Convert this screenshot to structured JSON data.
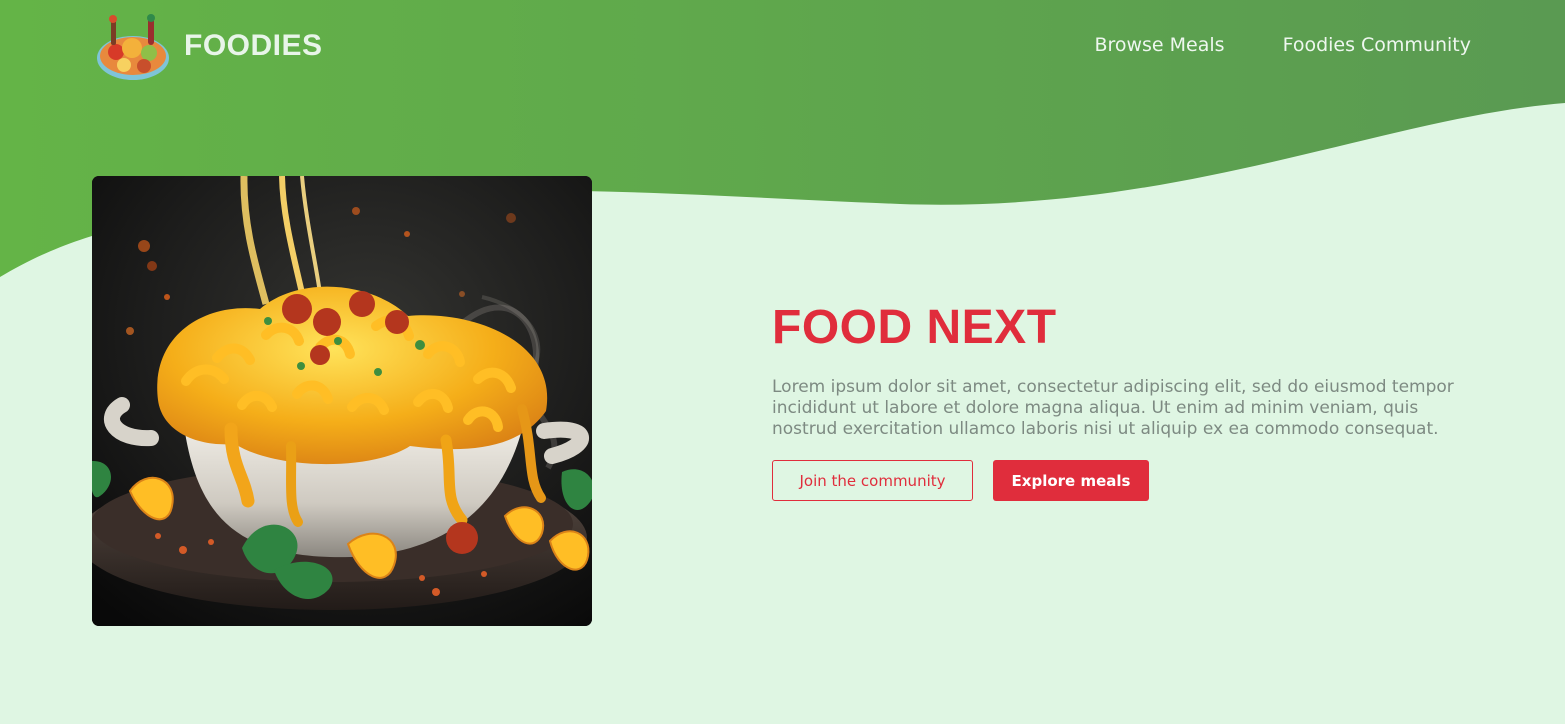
{
  "brand": {
    "name": "FOODIES",
    "logo_icon": "food-platter-logo"
  },
  "nav": {
    "items": [
      {
        "label": "Browse Meals"
      },
      {
        "label": "Foodies Community"
      }
    ]
  },
  "hero": {
    "image_subject": "macaroni-and-cheese-pot-image",
    "title": "FOOD NEXT",
    "description": "Lorem ipsum dolor sit amet, consectetur adipiscing elit, sed do eiusmod tempor incididunt ut labore et dolore magna aliqua. Ut enim ad minim veniam, quis nostrud exercitation ullamco laboris nisi ut aliquip ex ea commodo consequat.",
    "secondary_button": "Join the community",
    "primary_button": "Explore meals"
  },
  "colors": {
    "header_green": "#64b447",
    "background_mint": "#dff6e3",
    "accent_red": "#e02d3c",
    "body_gray": "#7d8a82"
  }
}
